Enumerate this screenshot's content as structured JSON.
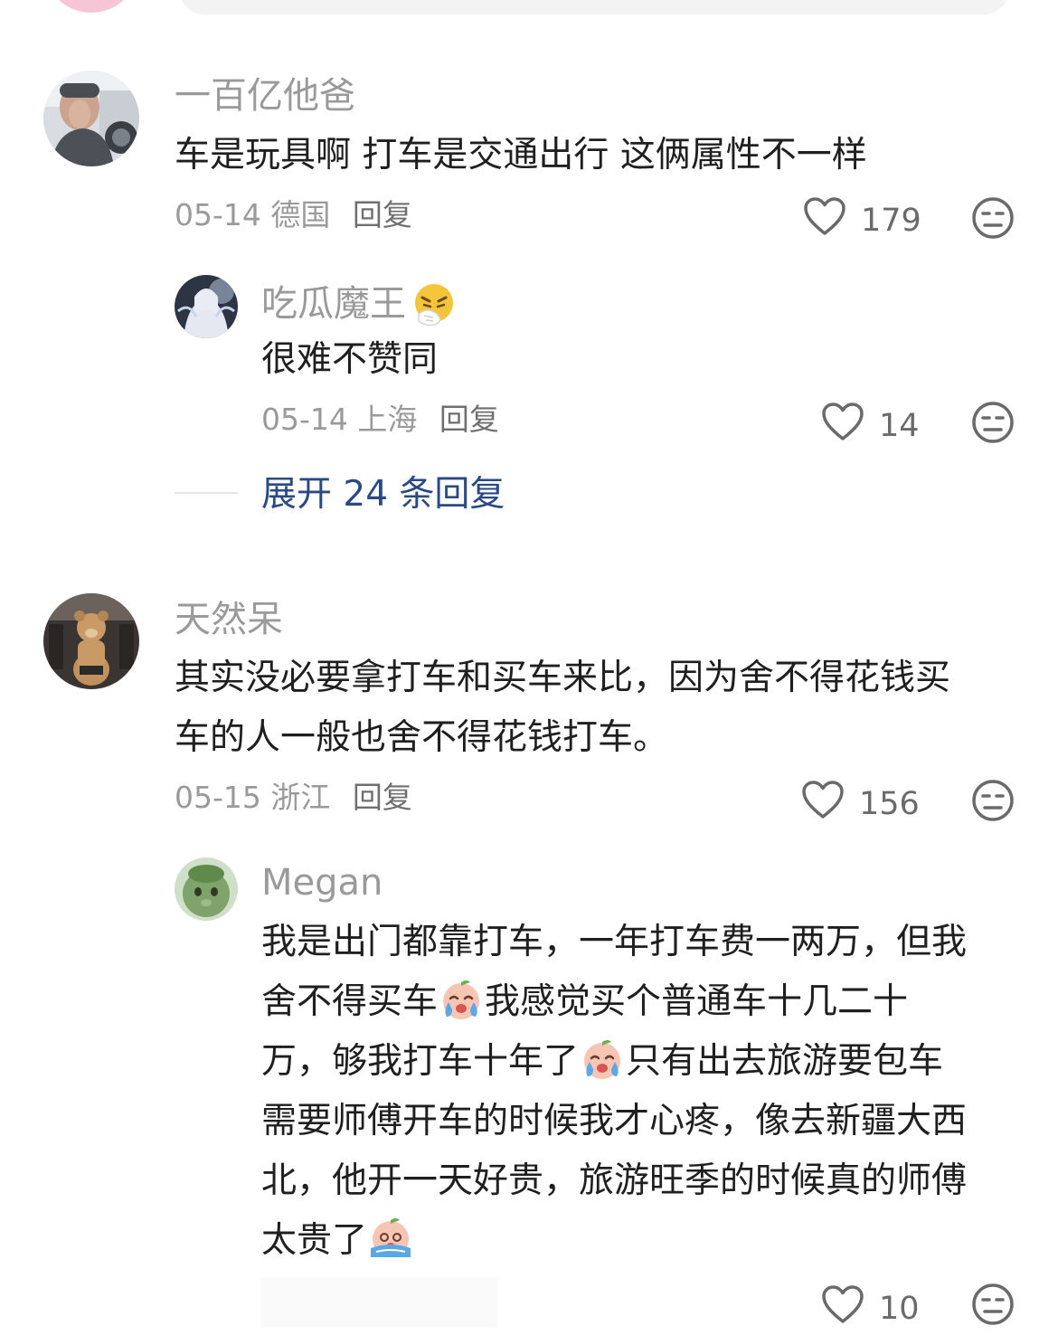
{
  "comments": [
    {
      "username": "一百亿他爸",
      "text": "车是玩具啊 打车是交通出行 这俩属性不一样",
      "date": "05-14",
      "location": "德国",
      "reply_label": "回复",
      "likes": "179",
      "replies": [
        {
          "username": "吃瓜魔王",
          "username_emoji": "sneezing-face-icon",
          "text": "很难不赞同",
          "date": "05-14",
          "location": "上海",
          "reply_label": "回复",
          "likes": "14"
        }
      ],
      "expand_label": "展开 24 条回复"
    },
    {
      "username": "天然呆",
      "text_line1": "其实没必要拿打车和买车来比，因为舍不得花钱买",
      "text_line2": "车的人一般也舍不得花钱打车。",
      "date": "05-15",
      "location": "浙江",
      "reply_label": "回复",
      "likes": "156",
      "replies": [
        {
          "username": "Megan",
          "line1": "我是出门都靠打车，一年打车费一两万，但我",
          "line2a": "舍不得买车",
          "line2b": "我感觉买个普通车十几二十",
          "line3a": "万，够我打车十年了",
          "line3b": "只有出去旅游要包车",
          "line4": "需要师傅开车的时候我才心疼，像去新疆大西",
          "line5": "北，他开一天好贵，旅游旺季的时候真的师傅",
          "line6": "太贵了",
          "emojis": [
            "crying-baby-icon",
            "crying-baby-icon",
            "wailing-baby-icon"
          ],
          "likes": "10"
        }
      ]
    }
  ],
  "icons": {
    "like": "heart-outline-icon",
    "dislike": "neutral-face-icon"
  },
  "colors": {
    "expand_link": "#2b4a84",
    "meta_text": "#9a9a9a",
    "body_text": "#1f1f1f"
  }
}
